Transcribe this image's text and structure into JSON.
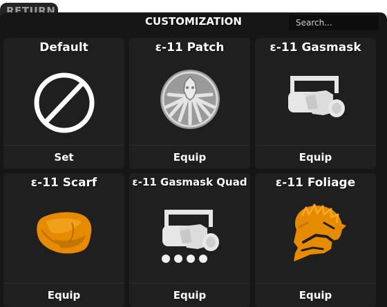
{
  "return_button": {
    "label": "RETURN"
  },
  "header": {
    "title": "CUSTOMIZATION"
  },
  "search": {
    "placeholder": "Search..."
  },
  "items": [
    {
      "name": "Default",
      "action": "Set",
      "icon": "none-icon"
    },
    {
      "name": "ε-11 Patch",
      "action": "Equip",
      "icon": "patch-icon"
    },
    {
      "name": "ε-11 Gasmask",
      "action": "Equip",
      "icon": "gasmask-icon"
    },
    {
      "name": "ε-11 Scarf",
      "action": "Equip",
      "icon": "scarf-icon"
    },
    {
      "name": "ε-11 Gasmask Quad",
      "action": "Equip",
      "icon": "gasmask-quad-icon"
    },
    {
      "name": "ε-11 Foliage",
      "action": "Equip",
      "icon": "foliage-icon"
    }
  ],
  "colors": {
    "panel": "#161616",
    "card": "#1f1f1f",
    "accent_orange": "#e68a00",
    "icon_light": "#e0e0e0"
  }
}
